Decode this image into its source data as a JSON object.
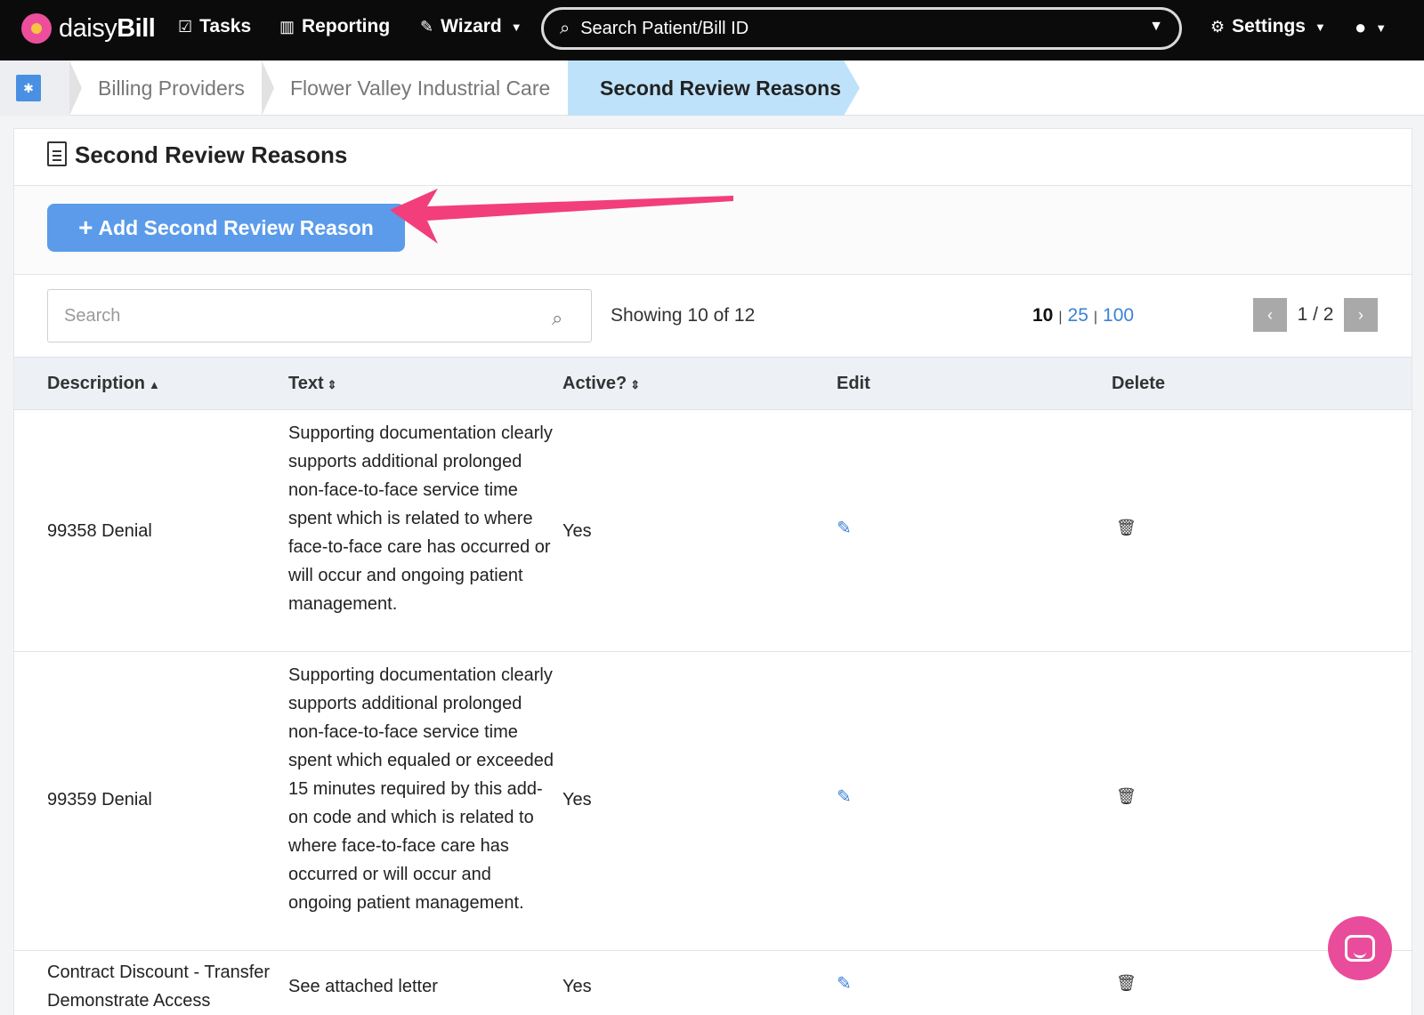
{
  "nav": {
    "logo_prefix": "daisy",
    "logo_suffix": "Bill",
    "tasks": "Tasks",
    "reporting": "Reporting",
    "wizard": "Wizard",
    "search_placeholder": "Search Patient/Bill ID",
    "settings": "Settings"
  },
  "breadcrumb": {
    "items": [
      "Billing Providers",
      "Flower Valley Industrial Care"
    ],
    "active": "Second Review Reasons"
  },
  "panel": {
    "title": "Second Review Reasons",
    "add_button": "Add Second Review Reason"
  },
  "listing": {
    "search_placeholder": "Search",
    "showing": "Showing 10 of 12",
    "page_sizes": [
      "10",
      "25",
      "100"
    ],
    "page_indicator": "1 / 2"
  },
  "table": {
    "headers": {
      "description": "Description",
      "text": "Text",
      "active": "Active?",
      "edit": "Edit",
      "delete": "Delete"
    },
    "rows": [
      {
        "description": "99358 Denial",
        "text": "Supporting documentation clearly supports additional prolonged non-face-to-face service time spent which is related to where face-to-face care has occurred or will occur and ongoing patient management.",
        "active": "Yes"
      },
      {
        "description": "99359 Denial",
        "text": "Supporting documentation clearly supports additional prolonged non-face-to-face service time spent which equaled or exceeded 15 minutes required by this add-on code and which is related to where face-to-face care has occurred or will occur and ongoing patient management.",
        "active": "Yes"
      },
      {
        "description": "Contract Discount - Transfer Demonstrate Access",
        "text": "See attached letter",
        "active": "Yes"
      }
    ]
  },
  "colors": {
    "accent_blue": "#5b9bea",
    "annotation_arrow": "#f23e7a",
    "breadcrumb_active": "#bfe2fb"
  }
}
